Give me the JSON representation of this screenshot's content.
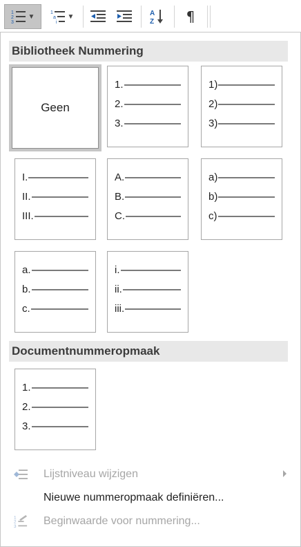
{
  "toolbar": {
    "buttons": [
      {
        "name": "numbering-list-icon",
        "selected": true,
        "dropdown": true
      },
      {
        "name": "multilevel-list-icon",
        "selected": false,
        "dropdown": true
      },
      {
        "name": "decrease-indent-icon",
        "selected": false,
        "dropdown": false
      },
      {
        "name": "increase-indent-icon",
        "selected": false,
        "dropdown": false
      },
      {
        "name": "sort-az-icon",
        "selected": false,
        "dropdown": false
      },
      {
        "name": "pilcrow-icon",
        "selected": false,
        "dropdown": false
      }
    ]
  },
  "library": {
    "title": "Bibliotheek Nummering",
    "none_label": "Geen",
    "formats": [
      [
        "1.",
        "2.",
        "3."
      ],
      [
        "1)",
        "2)",
        "3)"
      ],
      [
        "I.",
        "II.",
        "III."
      ],
      [
        "A.",
        "B.",
        "C."
      ],
      [
        "a)",
        "b)",
        "c)"
      ],
      [
        "a.",
        "b.",
        "c."
      ],
      [
        "i.",
        "ii.",
        "iii."
      ]
    ]
  },
  "document": {
    "title": "Documentnummeropmaak",
    "formats": [
      [
        "1.",
        "2.",
        "3."
      ]
    ]
  },
  "commands": {
    "change_level": "Lijstniveau wijzigen",
    "define_new": "Nieuwe nummeropmaak definiëren...",
    "set_value": "Beginwaarde voor nummering..."
  },
  "colors": {
    "header_bg": "#e8e8e8",
    "disabled_text": "#a6a6a6",
    "selected_bg": "#c5c5c5"
  }
}
